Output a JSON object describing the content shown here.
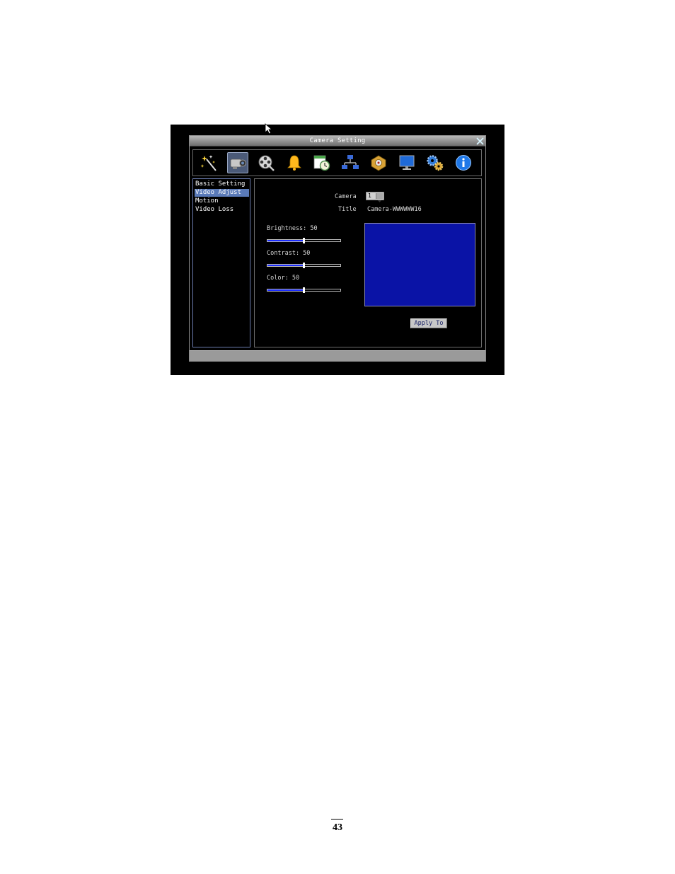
{
  "window": {
    "title": "Camera Setting"
  },
  "toolbar": {
    "icons": [
      {
        "name": "wizard-icon",
        "active": false
      },
      {
        "name": "camera-icon",
        "active": true
      },
      {
        "name": "record-icon",
        "active": false
      },
      {
        "name": "alarm-bell-icon",
        "active": false
      },
      {
        "name": "schedule-icon",
        "active": false
      },
      {
        "name": "network-icon",
        "active": false
      },
      {
        "name": "storage-icon",
        "active": false
      },
      {
        "name": "display-monitor-icon",
        "active": false
      },
      {
        "name": "system-gears-icon",
        "active": false
      },
      {
        "name": "info-icon",
        "active": false
      }
    ]
  },
  "sidebar": {
    "items": [
      {
        "label": "Basic Setting",
        "selected": false
      },
      {
        "label": "Video Adjust",
        "selected": true
      },
      {
        "label": "Motion",
        "selected": false
      },
      {
        "label": "Video Loss",
        "selected": false
      }
    ]
  },
  "panel": {
    "camera_label": "Camera",
    "camera_value": "1",
    "title_label": "Title",
    "title_value": "Camera-WWWWWW16",
    "brightness_label": "Brightness: 50",
    "brightness_value": 50,
    "contrast_label": "Contrast: 50",
    "contrast_value": 50,
    "color_label": "Color: 50",
    "color_value": 50,
    "slider_max": 100,
    "apply_label": "Apply To",
    "preview_color": "#0a13a6"
  },
  "page": {
    "number": "43"
  }
}
